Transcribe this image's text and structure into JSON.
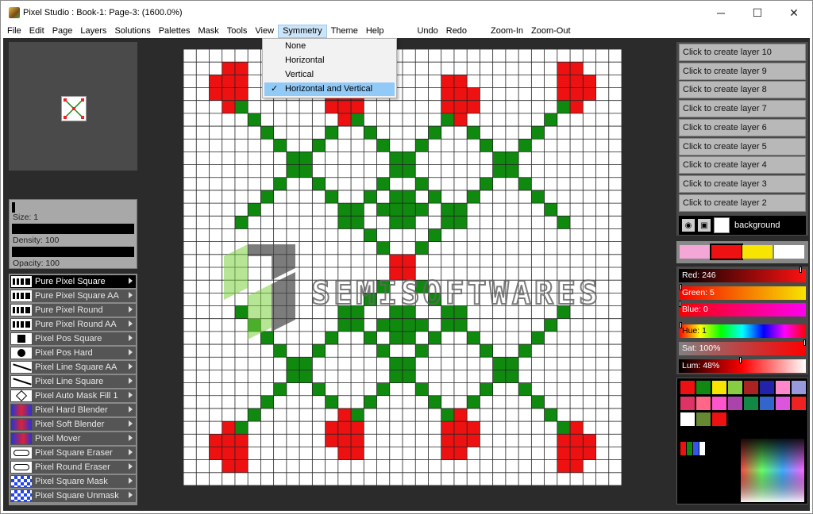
{
  "window": {
    "title": "Pixel Studio : Book-1: Page-3:  (1600.0%)",
    "minimize_glyph": "─",
    "maximize_glyph": "☐",
    "close_glyph": "✕"
  },
  "menubar": {
    "items": [
      "File",
      "Edit",
      "Page",
      "Layers",
      "Solutions",
      "Palettes",
      "Mask",
      "Tools",
      "View",
      "Symmetry",
      "Theme",
      "Help"
    ],
    "undo": "Undo",
    "redo": "Redo",
    "zoom_in": "Zoom-In",
    "zoom_out": "Zoom-Out"
  },
  "symmetry_menu": {
    "items": [
      "None",
      "Horizontal",
      "Vertical",
      "Horizontal and Vertical"
    ],
    "checked": "Horizontal and Vertical",
    "check_glyph": "✓"
  },
  "brush": {
    "size_label": "Size: 1",
    "density_label": "Density: 100",
    "opacity_label": "Opacity: 100"
  },
  "tools": [
    {
      "label": "Pure Pixel Square",
      "icon": "pure-pixel-square-icon",
      "selected": true
    },
    {
      "label": "Pure Pixel Square AA",
      "icon": "pure-pixel-square-aa-icon"
    },
    {
      "label": "Pure Pixel Round",
      "icon": "pure-pixel-round-icon"
    },
    {
      "label": "Pure Pixel Round AA",
      "icon": "pure-pixel-round-aa-icon"
    },
    {
      "label": "Pixel Pos Square",
      "icon": "pos-square-icon"
    },
    {
      "label": "Pixel Pos Hard",
      "icon": "pos-hard-icon"
    },
    {
      "label": "Pixel Line Square AA",
      "icon": "line-square-aa-icon"
    },
    {
      "label": "Pixel Line Square",
      "icon": "line-square-icon"
    },
    {
      "label": "Pixel Auto Mask Fill 1",
      "icon": "auto-mask-fill-icon"
    },
    {
      "label": "Pixel Hard Blender",
      "icon": "hard-blender-icon"
    },
    {
      "label": "Pixel Soft Blender",
      "icon": "soft-blender-icon"
    },
    {
      "label": "Pixel Mover",
      "icon": "mover-icon"
    },
    {
      "label": "Pixel Square Eraser",
      "icon": "square-eraser-icon"
    },
    {
      "label": "Pixel Round Eraser",
      "icon": "round-eraser-icon"
    },
    {
      "label": "Pixel Square Mask",
      "icon": "square-mask-icon"
    },
    {
      "label": "Pixel Square Unmask",
      "icon": "square-unmask-icon"
    }
  ],
  "layers": {
    "create_buttons": [
      "Click to create layer 10",
      "Click to create layer 9",
      "Click to create layer 8",
      "Click to create layer 7",
      "Click to create layer 6",
      "Click to create layer 5",
      "Click to create layer 4",
      "Click to create layer 3",
      "Click to create layer 2"
    ],
    "background_label": "background"
  },
  "color": {
    "red_label": "Red: 246",
    "green_label": "Green: 5",
    "blue_label": "Blue: 0",
    "hue_label": "Hue: 1",
    "sat_label": "Sat: 100%",
    "lum_label": "Lum: 48%",
    "red": 246,
    "green": 5,
    "blue": 0,
    "hue": 1,
    "sat": 100,
    "lum": 48
  },
  "palette_strip": [
    "#f4a6d7",
    "#ee1111",
    "#f7e400",
    "#ffffff"
  ],
  "swatches": [
    "#ee1111",
    "#118811",
    "#f7e400",
    "#88cc44",
    "#aa2222",
    "#2222aa",
    "#ff88cc",
    "#9999dd",
    "#dd3366",
    "#ff6688",
    "#ff55cc",
    "#aa44aa",
    "#118844",
    "#3366cc",
    "#dd55dd",
    "#ee2222",
    "#ffffff",
    "#668833",
    "#ee1111"
  ],
  "recent_colors": [
    "#ee1111",
    "#118811",
    "#3355ee",
    "#ffffff"
  ],
  "canvas": {
    "grid_size": 34,
    "pixel_green": "#0f8a0f",
    "pixel_red": "#ee1111",
    "grid_color": "#222222"
  },
  "watermark": {
    "text": "SEMISOFTWARES"
  }
}
